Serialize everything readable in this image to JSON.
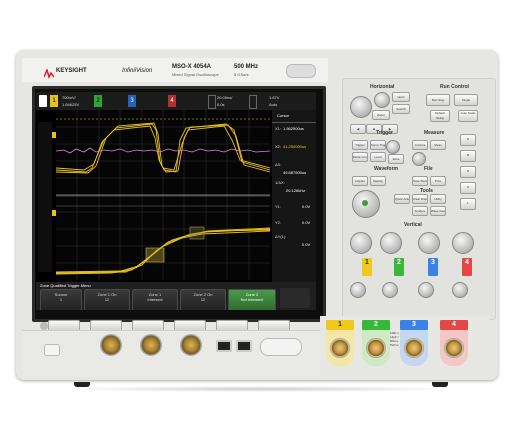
{
  "brand": {
    "logo": "KEYSIGHT",
    "series": "InfiniiVision",
    "model": "MSO-X 4054A",
    "model_sub": "Mixed Signal Oscilloscope",
    "bandwidth": "500 MHz",
    "sample_rate": "5 GSa/s"
  },
  "screen": {
    "ch1_scale": "700mV/",
    "ch1_offset": "1.64625V",
    "time_scale": "20.00ns/",
    "time_delay": "0.0s",
    "trig_level": "1.67V",
    "trig_mode": "Auto",
    "cursor_title": "Cursor",
    "cursors": [
      {
        "label": "X1:",
        "value": "1.562500us"
      },
      {
        "label": "X2:",
        "value": "41.250000us"
      },
      {
        "label": "ΔX:",
        "value": "49.687500us"
      },
      {
        "label": "1/ΔX:",
        "value": "20.126kHz"
      },
      {
        "label": "Y1:",
        "value": "0.0V"
      },
      {
        "label": "Y2:",
        "value": "0.0V"
      },
      {
        "label": "ΔY(1):",
        "value": "0.0V"
      }
    ],
    "menu_title": "Zone Qualified Trigger Menu",
    "softkeys": [
      {
        "title": "Source",
        "value": "1"
      },
      {
        "title": "Zone 1 On",
        "value": "☑"
      },
      {
        "title": "Zone 1",
        "value": "Intersect"
      },
      {
        "title": "Zone 2 On",
        "value": "☑"
      },
      {
        "title": "Zone 2",
        "value": "Not Intersect"
      }
    ]
  },
  "panel": {
    "horizontal": "Horizontal",
    "run_control": "Run Control",
    "run_stop": "Run Stop",
    "single": "Single",
    "default_setup": "Default Setup",
    "auto_scale": "Auto Scale",
    "trigger": "Trigger",
    "measure": "Measure",
    "waveform": "Waveform",
    "file": "File",
    "tools": "Tools",
    "vertical": "Vertical",
    "trig_keys": [
      "Trigger",
      "Force Trigger",
      "Mode Coupling",
      "Level",
      "Zone",
      "Cursors",
      "Meas"
    ],
    "wave_keys": [
      "Acquire",
      "Display",
      "Save Recall",
      "Print",
      "Quick Action"
    ],
    "tools_keys": [
      "Clear Display",
      "Utility",
      "Analyze",
      "Wave Gen"
    ],
    "channels": [
      "1",
      "2",
      "3",
      "4"
    ]
  },
  "front": {
    "probe_note": "1MΩ ≈ 14pF / 50Ω ≤ 5Vrms"
  },
  "colors": {
    "ch1": "#f1c81c",
    "ch2": "#32c832",
    "ch3": "#3a82e6",
    "ch4": "#e64646",
    "softkey_selected": "#3c8a3c"
  }
}
